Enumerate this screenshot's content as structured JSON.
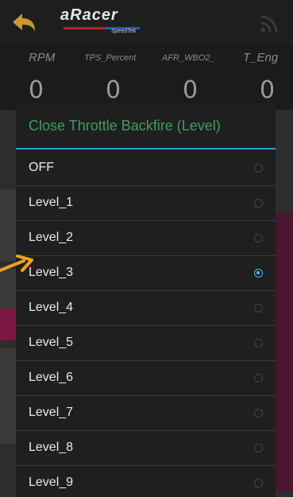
{
  "app": {
    "brand_name": "aRacer",
    "brand_sub": "SpeedTek",
    "icons": {
      "back": "back-arrow-icon",
      "signal": "signal-icon"
    }
  },
  "gauges": [
    {
      "label": "RPM",
      "value": "0"
    },
    {
      "label": "TPS_Percent",
      "value": "0"
    },
    {
      "label": "AFR_WBO2_",
      "value": "0"
    },
    {
      "label": "T_Eng",
      "value": "0"
    }
  ],
  "dialog": {
    "title": "Close Throttle Backfire (Level)",
    "selected": "Level_3",
    "options": [
      "OFF",
      "Level_1",
      "Level_2",
      "Level_3",
      "Level_4",
      "Level_5",
      "Level_6",
      "Level_7",
      "Level_8",
      "Level_9"
    ]
  },
  "colors": {
    "title_green": "#3f9c63",
    "divider_blue": "#2aa7c4",
    "radio_selected": "#4fb7ea",
    "annotation_arrow": "#f0a21c"
  }
}
